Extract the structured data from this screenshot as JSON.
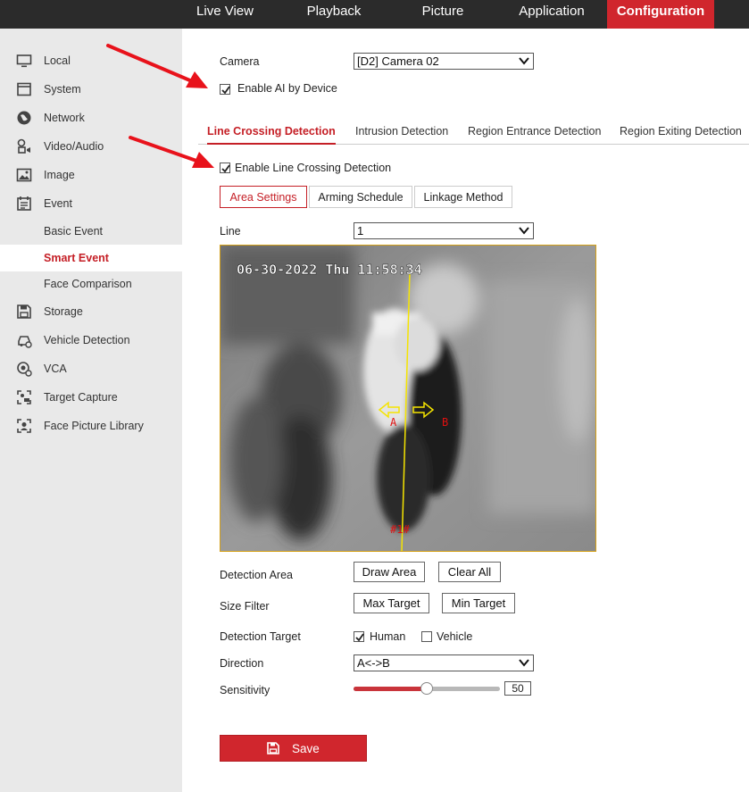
{
  "topnav": {
    "items": [
      "Live View",
      "Playback",
      "Picture",
      "Application",
      "Configuration"
    ],
    "active": "Configuration"
  },
  "sidebar": {
    "items": [
      {
        "label": "Local",
        "icon": "monitor-icon"
      },
      {
        "label": "System",
        "icon": "system-icon"
      },
      {
        "label": "Network",
        "icon": "globe-icon"
      },
      {
        "label": "Video/Audio",
        "icon": "video-audio-icon"
      },
      {
        "label": "Image",
        "icon": "image-icon"
      },
      {
        "label": "Event",
        "icon": "calendar-icon"
      },
      {
        "label": "Basic Event"
      },
      {
        "label": "Smart Event"
      },
      {
        "label": "Face Comparison"
      },
      {
        "label": "Storage",
        "icon": "floppy-icon"
      },
      {
        "label": "Vehicle Detection",
        "icon": "vehicle-icon"
      },
      {
        "label": "VCA",
        "icon": "vca-icon"
      },
      {
        "label": "Target Capture",
        "icon": "target-capture-icon"
      },
      {
        "label": "Face Picture Library",
        "icon": "face-library-icon"
      }
    ],
    "active": "Smart Event"
  },
  "camera": {
    "label": "Camera",
    "value": "[D2] Camera 02"
  },
  "enable_ai": {
    "label": "Enable AI by Device",
    "checked": true
  },
  "tabs": [
    "Line Crossing Detection",
    "Intrusion Detection",
    "Region Entrance Detection",
    "Region Exiting Detection"
  ],
  "enable_line": {
    "label": "Enable Line Crossing Detection",
    "checked": true
  },
  "subtabs": [
    "Area Settings",
    "Arming Schedule",
    "Linkage Method"
  ],
  "line": {
    "label": "Line",
    "value": "1"
  },
  "video": {
    "timestamp": "06-30-2022 Thu 11:58:34",
    "marker_a": "A",
    "marker_b": "B",
    "line_id": "#1#"
  },
  "detection_area": {
    "label": "Detection Area",
    "draw": "Draw Area",
    "clear": "Clear All"
  },
  "size_filter": {
    "label": "Size Filter",
    "max": "Max Target",
    "min": "Min Target"
  },
  "detection_target": {
    "label": "Detection Target",
    "human": "Human",
    "human_checked": true,
    "vehicle": "Vehicle",
    "vehicle_checked": false
  },
  "direction": {
    "label": "Direction",
    "value": "A<->B"
  },
  "sensitivity": {
    "label": "Sensitivity",
    "value": "50",
    "level": 50
  },
  "save_label": "Save",
  "colors": {
    "accent": "#d0262d",
    "topbar": "#2b2b2b",
    "sidebar": "#e9e9e9",
    "line": "#f5e400"
  }
}
